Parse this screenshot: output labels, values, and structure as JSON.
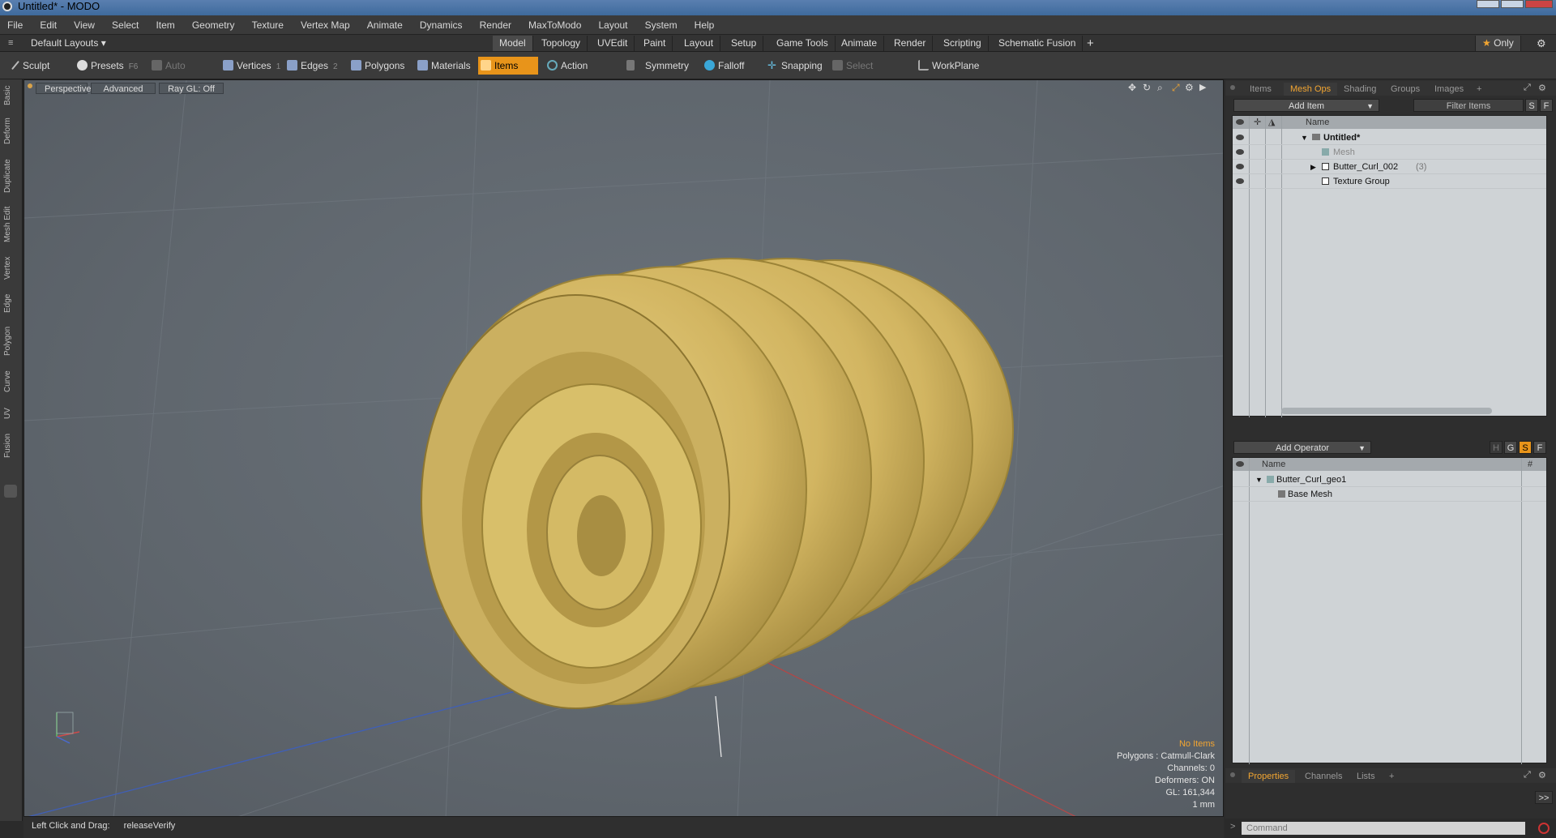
{
  "window": {
    "title": "Untitled* - MODO"
  },
  "menu": [
    "File",
    "Edit",
    "View",
    "Select",
    "Item",
    "Geometry",
    "Texture",
    "Vertex Map",
    "Animate",
    "Dynamics",
    "Render",
    "MaxToModo",
    "Layout",
    "System",
    "Help"
  ],
  "layout": {
    "selector": "Default Layouts",
    "tabs": [
      "Model",
      "Topology",
      "UVEdit",
      "Paint",
      "Layout",
      "Setup",
      "Game Tools",
      "Animate",
      "Render",
      "Scripting",
      "Schematic Fusion"
    ],
    "active_tab": "Model",
    "add": "+",
    "only": "Only"
  },
  "toolbar": {
    "sculpt": "Sculpt",
    "presets": "Presets",
    "presets_key": "F6",
    "auto_select": "Auto Select",
    "vertices": "Vertices",
    "vertices_key": "1",
    "edges": "Edges",
    "edges_key": "2",
    "polygons": "Polygons",
    "materials": "Materials",
    "items": "Items",
    "action_center": "Action Center",
    "symmetry": "Symmetry",
    "falloff": "Falloff",
    "snapping": "Snapping",
    "select_through": "Select Through",
    "workplane": "WorkPlane"
  },
  "left_tabs": [
    "Basic",
    "Deform",
    "Duplicate",
    "Mesh Edit",
    "Vertex",
    "Edge",
    "Polygon",
    "Curve",
    "UV",
    "Fusion"
  ],
  "viewport": {
    "view": "Perspective",
    "mode": "Advanced",
    "raygl": "Ray GL: Off",
    "info": {
      "items": "No Items",
      "polygons": "Polygons : Catmull-Clark",
      "channels": "Channels: 0",
      "deformers": "Deformers: ON",
      "gl": "GL: 161,344",
      "unit": "1 mm"
    },
    "object_color": "#d8bf6a"
  },
  "status": {
    "label": "Left Click and Drag:",
    "value": "releaseVerify"
  },
  "items_panel": {
    "tabs": [
      "Items",
      "Mesh Ops",
      "Shading",
      "Groups",
      "Images",
      "+"
    ],
    "active_tab": "Mesh Ops",
    "add_item": "Add Item",
    "filter": "Filter Items",
    "s": "S",
    "f": "F",
    "col_name": "Name",
    "rows": [
      {
        "name": "Untitled*",
        "extra": ""
      },
      {
        "name": "Mesh",
        "extra": ""
      },
      {
        "name": "Butter_Curl_002",
        "extra": "(3)"
      },
      {
        "name": "Texture Group",
        "extra": ""
      }
    ]
  },
  "meshops_panel": {
    "add_operator": "Add Operator",
    "h": "H",
    "g": "G",
    "s": "S",
    "f": "F",
    "col_name": "Name",
    "col_hash": "#",
    "rows": [
      {
        "name": "Butter_Curl_geo1"
      },
      {
        "name": "Base Mesh"
      }
    ]
  },
  "bottom_panel": {
    "tabs": [
      "Properties",
      "Channels",
      "Lists",
      "+"
    ],
    "active_tab": "Properties",
    "expand": ">>",
    "command_placeholder": "Command"
  },
  "colors": {
    "accent": "#e8941a",
    "active_text": "#f2a531"
  }
}
